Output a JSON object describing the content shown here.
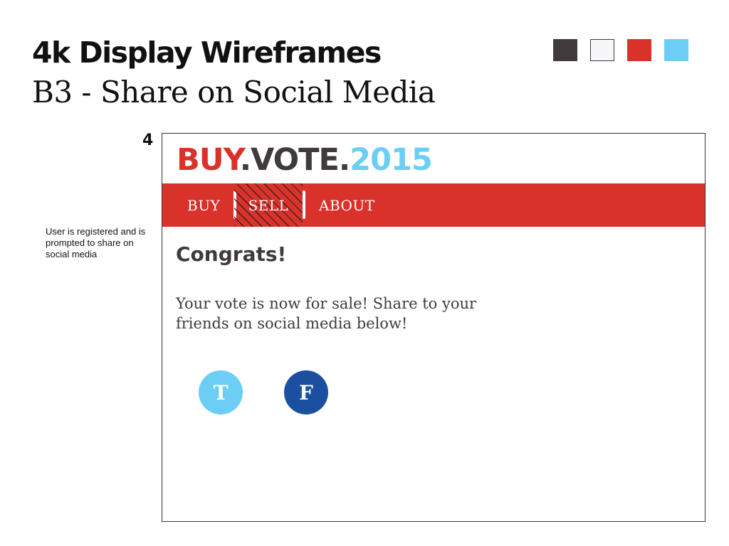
{
  "header": {
    "title": "4k Display Wireframes",
    "subtitle": "B3 - Share on Social Media"
  },
  "palette": [
    {
      "name": "dark-gray",
      "hex": "#403a3c"
    },
    {
      "name": "off-white",
      "hex": "#f7f7f9"
    },
    {
      "name": "red",
      "hex": "#d9322b"
    },
    {
      "name": "light-blue",
      "hex": "#6ccef5"
    }
  ],
  "step": {
    "number": "4",
    "annotation": "User is registered and is prompted to share on social media"
  },
  "site": {
    "logo": {
      "part1": "BUY",
      "part2": ".VOTE.",
      "part3": "2015"
    },
    "nav": {
      "items": [
        {
          "label": "BUY",
          "active": false
        },
        {
          "label": "SELL",
          "active": true
        },
        {
          "label": "ABOUT",
          "active": false
        }
      ]
    },
    "content": {
      "heading": "Congrats!",
      "body": "Your vote is now for sale! Share to your friends on social media below!"
    },
    "social": {
      "twitter": {
        "letter": "T",
        "icon": "twitter-icon"
      },
      "facebook": {
        "letter": "F",
        "icon": "facebook-icon"
      }
    }
  },
  "colors": {
    "brand_red": "#d9322b",
    "brand_dark": "#403a3c",
    "brand_blue": "#6ccef5",
    "facebook_blue": "#1b4f9f",
    "nav_text": "#ffffff"
  }
}
